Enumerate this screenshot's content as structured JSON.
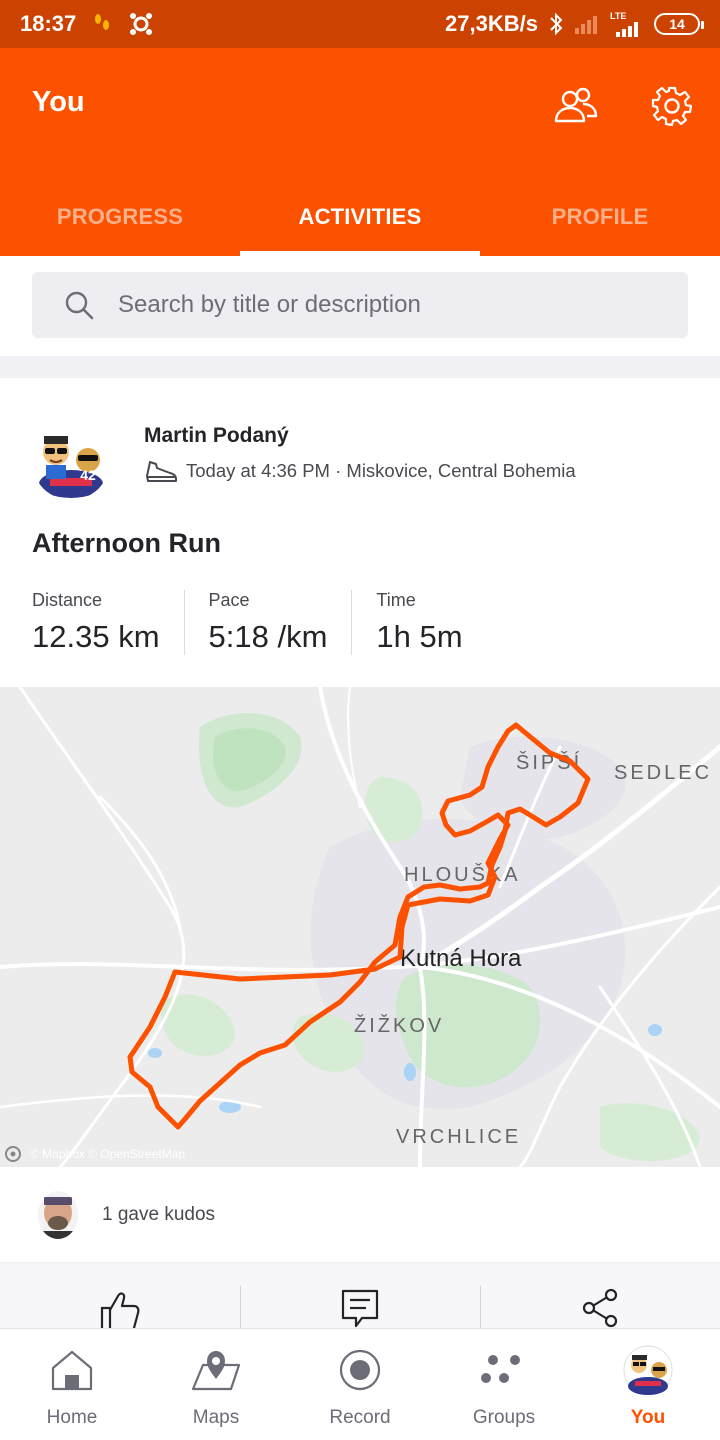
{
  "status_bar": {
    "time": "18:37",
    "speed": "27,3KB/s",
    "network": "LTE",
    "battery": "14"
  },
  "header": {
    "title": "You",
    "tabs": [
      {
        "label": "PROGRESS",
        "active": false
      },
      {
        "label": "ACTIVITIES",
        "active": true
      },
      {
        "label": "PROFILE",
        "active": false
      }
    ]
  },
  "search": {
    "placeholder": "Search by title or description"
  },
  "activity": {
    "athlete": "Martin Podaný",
    "meta": "Today at 4:36 PM · Miskovice, Central Bohemia",
    "title": "Afternoon Run",
    "stats": [
      {
        "label": "Distance",
        "value": "12.35 km"
      },
      {
        "label": "Pace",
        "value": "5:18 /km"
      },
      {
        "label": "Time",
        "value": "1h 5m"
      }
    ],
    "map": {
      "labels": {
        "sipsi": "ŠIPŠÍ",
        "sedlec": "SEDLEC",
        "hlouska": "HLOUŠKA",
        "city": "Kutná Hora",
        "zizkov": "ŽIŽKOV",
        "vrchlice": "VRCHLICE"
      },
      "attribution": "© Mapbox © OpenStreetMap",
      "route_color": "#fc5200"
    },
    "kudos_text": "1 gave kudos"
  },
  "bottom_nav": [
    {
      "label": "Home",
      "icon": "home-icon",
      "active": false
    },
    {
      "label": "Maps",
      "icon": "maps-icon",
      "active": false
    },
    {
      "label": "Record",
      "icon": "record-icon",
      "active": false
    },
    {
      "label": "Groups",
      "icon": "groups-icon",
      "active": false
    },
    {
      "label": "You",
      "icon": "you-avatar-icon",
      "active": true
    }
  ],
  "colors": {
    "brand": "#fc5200",
    "status_bar": "#cc4200"
  }
}
